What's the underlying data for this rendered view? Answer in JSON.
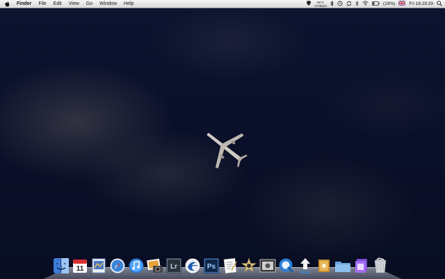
{
  "menubar": {
    "app_name": "Finder",
    "menus": [
      "File",
      "Edit",
      "View",
      "Go",
      "Window",
      "Help"
    ],
    "status": {
      "temperature": "59°C",
      "fan_speed": "2728rpm",
      "battery": "(19%)",
      "clock": "Fri 18:29:29"
    }
  },
  "dock": {
    "items": [
      {
        "name": "finder",
        "icon": "finder-icon"
      },
      {
        "name": "calendar",
        "icon": "calendar-icon",
        "label": "11"
      },
      {
        "name": "preview",
        "icon": "preview-icon"
      },
      {
        "name": "safari",
        "icon": "safari-icon"
      },
      {
        "name": "itunes",
        "icon": "itunes-icon"
      },
      {
        "name": "iphoto",
        "icon": "iphoto-icon"
      },
      {
        "name": "lightroom",
        "icon": "lightroom-icon",
        "label": "Lr"
      },
      {
        "name": "sync",
        "icon": "sync-icon"
      },
      {
        "name": "photoshop",
        "icon": "photoshop-icon",
        "label": "Ps"
      },
      {
        "name": "textedit",
        "icon": "textedit-icon"
      },
      {
        "name": "imovie",
        "icon": "imovie-icon"
      },
      {
        "name": "photo-booth",
        "icon": "photo-booth-icon"
      },
      {
        "name": "quicktime",
        "icon": "quicktime-icon"
      },
      {
        "name": "flickr-uploader",
        "icon": "flickr-uploader-icon",
        "label": "flickr"
      },
      {
        "name": "applications-stack",
        "icon": "stack-icon"
      },
      {
        "name": "documents-folder",
        "icon": "folder-icon"
      },
      {
        "name": "downloads-stack",
        "icon": "stack-icon"
      },
      {
        "name": "trash",
        "icon": "trash-icon"
      }
    ]
  },
  "colors": {
    "sky": "#0b1126",
    "menubar": "#e6e6e6"
  }
}
